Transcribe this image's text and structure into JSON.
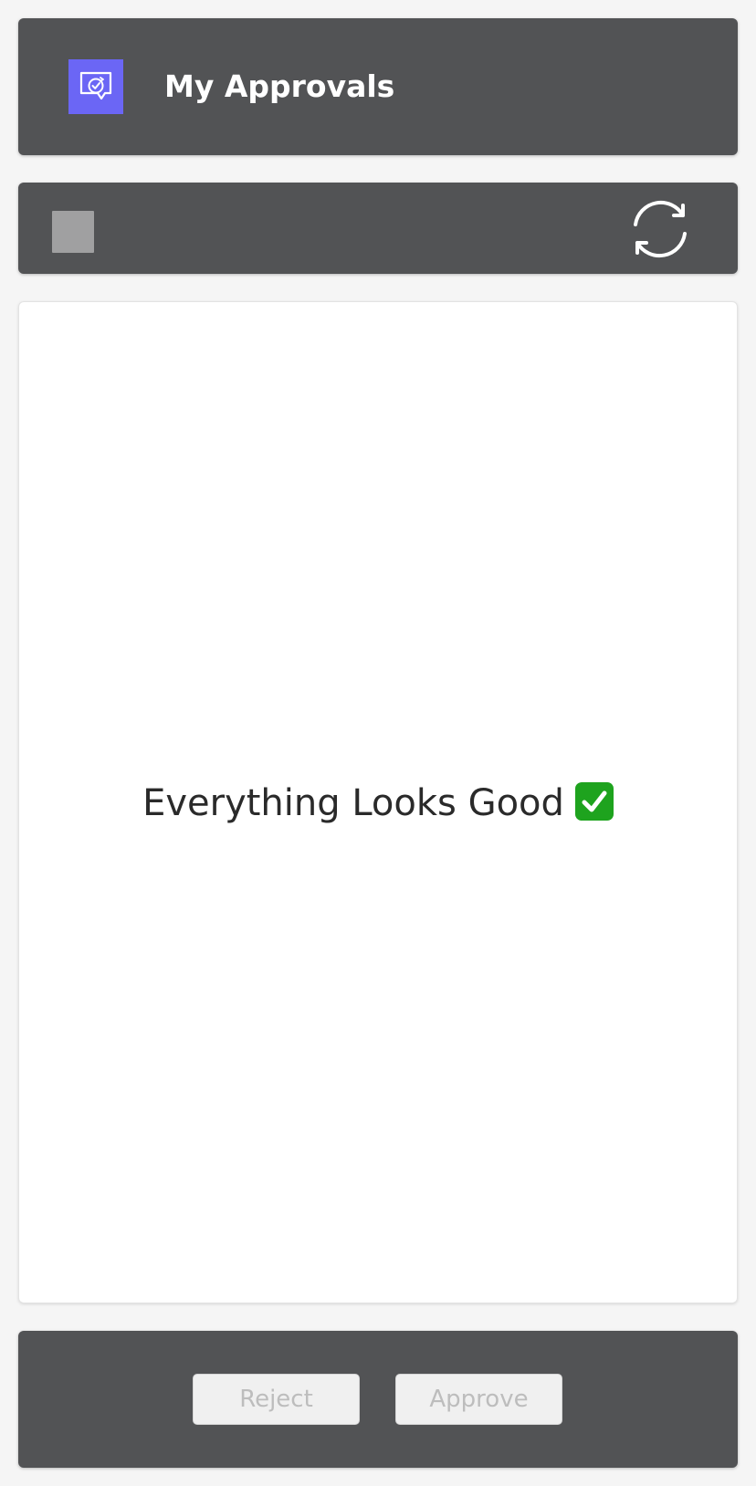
{
  "header": {
    "title": "My Approvals",
    "icon": "approvals-app-icon",
    "icon_color": "#6b66f5"
  },
  "toolbar": {
    "select_all_icon": "checkbox-icon",
    "refresh_icon": "refresh-icon"
  },
  "content": {
    "empty_message": "Everything Looks Good",
    "status_icon": "check-mark-button-icon"
  },
  "footer": {
    "reject_label": "Reject",
    "approve_label": "Approve"
  },
  "colors": {
    "panel": "#525355",
    "background": "#f5f5f5",
    "accent": "#6b66f5",
    "success": "#1ea31e"
  }
}
